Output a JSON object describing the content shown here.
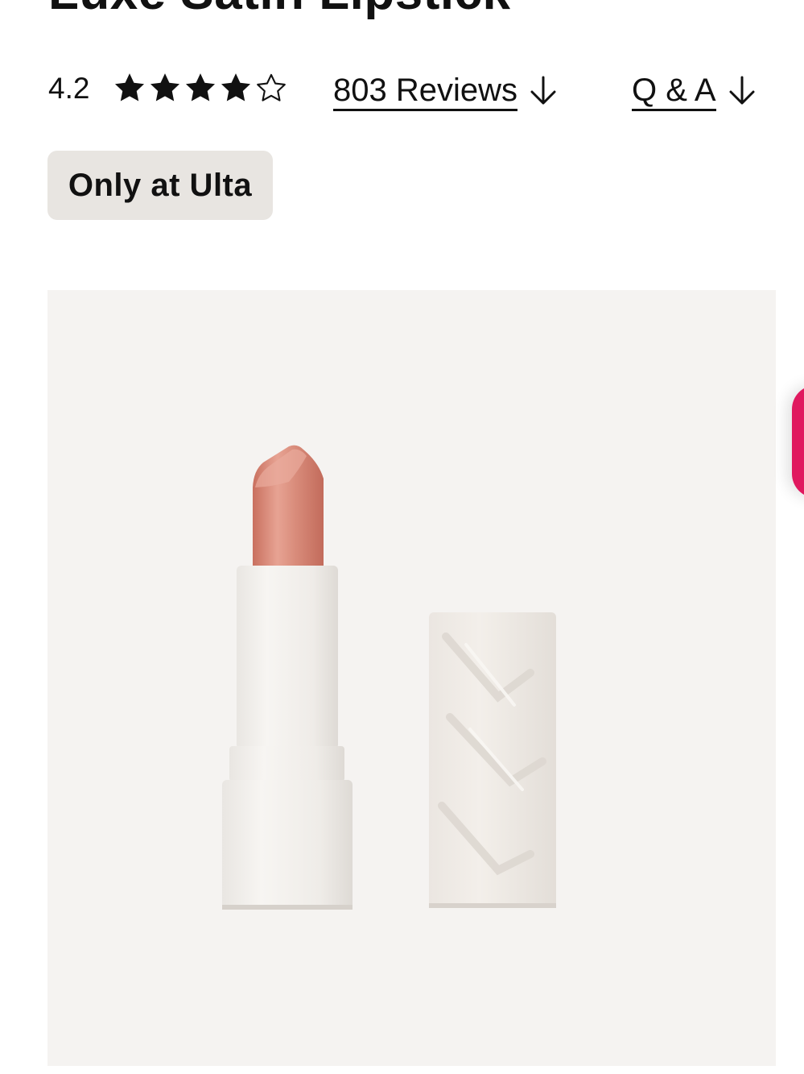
{
  "product": {
    "title": "Luxe Satin Lipstick"
  },
  "rating": {
    "value": "4.2",
    "stars_filled": 4,
    "stars_total": 5,
    "reviews_label": "803 Reviews",
    "qa_label": "Q & A"
  },
  "badge": {
    "label": "Only at Ulta"
  },
  "colors": {
    "accent_pink": "#e0195f",
    "badge_bg": "#e8e5e1",
    "image_bg": "#f5f3f1",
    "lipstick_bullet": "#d88a78"
  },
  "icons": {
    "star_filled": "star-filled-icon",
    "star_empty": "star-outline-icon",
    "arrow": "arrow-down-icon"
  }
}
